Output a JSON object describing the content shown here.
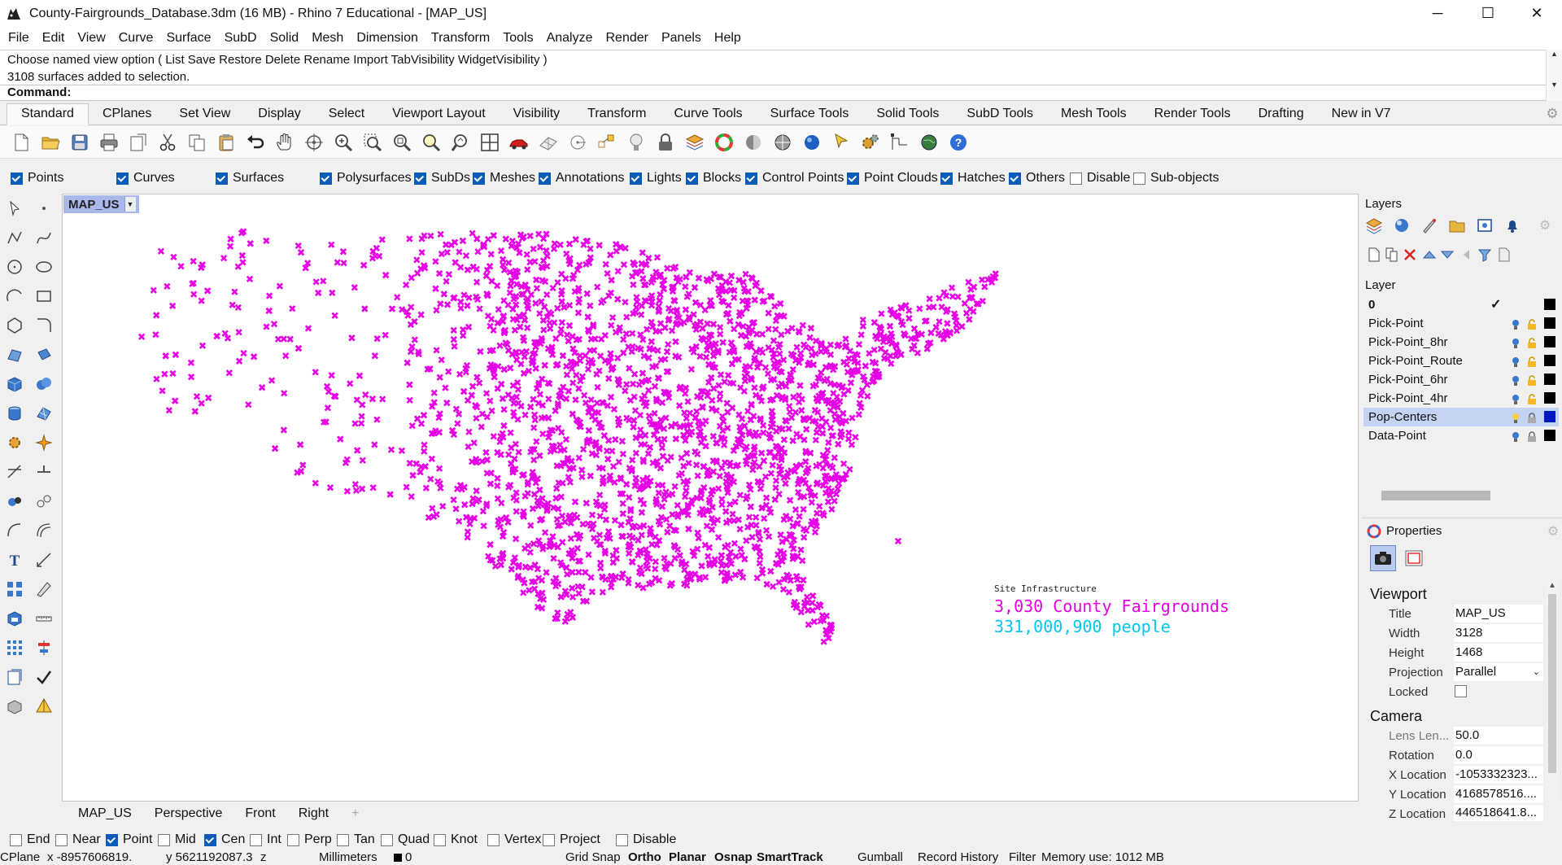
{
  "window": {
    "title": "County-Fairgrounds_Database.3dm (16 MB) - Rhino 7 Educational - [MAP_US]",
    "minimize": "─",
    "maximize": "☐",
    "close": "✕"
  },
  "menu": [
    "File",
    "Edit",
    "View",
    "Curve",
    "Surface",
    "SubD",
    "Solid",
    "Mesh",
    "Dimension",
    "Transform",
    "Tools",
    "Analyze",
    "Render",
    "Panels",
    "Help"
  ],
  "command": {
    "history": [
      "Choose named view option ( List  Save  Restore  Delete  Rename  Import  TabVisibility  WidgetVisibility )",
      "3108 surfaces added to selection."
    ],
    "prompt": "Command:"
  },
  "toolbar_tabs": [
    "Standard",
    "CPlanes",
    "Set View",
    "Display",
    "Select",
    "Viewport Layout",
    "Visibility",
    "Transform",
    "Curve Tools",
    "Surface Tools",
    "Solid Tools",
    "SubD Tools",
    "Mesh Tools",
    "Render Tools",
    "Drafting",
    "New in V7"
  ],
  "selection_filter": [
    {
      "label": "Points",
      "checked": true
    },
    {
      "label": "Curves",
      "checked": true
    },
    {
      "label": "Surfaces",
      "checked": true
    },
    {
      "label": "Polysurfaces",
      "checked": true
    },
    {
      "label": "SubDs",
      "checked": true
    },
    {
      "label": "Meshes",
      "checked": true
    },
    {
      "label": "Annotations",
      "checked": true
    },
    {
      "label": "Lights",
      "checked": true
    },
    {
      "label": "Blocks",
      "checked": true
    },
    {
      "label": "Control Points",
      "checked": true
    },
    {
      "label": "Point Clouds",
      "checked": true
    },
    {
      "label": "Hatches",
      "checked": true
    },
    {
      "label": "Others",
      "checked": true
    },
    {
      "label": "Disable",
      "checked": false
    },
    {
      "label": "Sub-objects",
      "checked": false
    }
  ],
  "viewport": {
    "name": "MAP_US",
    "point_color": "#e600e6",
    "annotation": {
      "small": "Site Infrastructure",
      "fairgrounds": "3,030 County Fairgrounds",
      "people": "331,000,900 people"
    }
  },
  "viewport_tabs": [
    "MAP_US",
    "Perspective",
    "Front",
    "Right"
  ],
  "osnap": [
    {
      "label": "End",
      "checked": false
    },
    {
      "label": "Near",
      "checked": false
    },
    {
      "label": "Point",
      "checked": true
    },
    {
      "label": "Mid",
      "checked": false
    },
    {
      "label": "Cen",
      "checked": true
    },
    {
      "label": "Int",
      "checked": false
    },
    {
      "label": "Perp",
      "checked": false
    },
    {
      "label": "Tan",
      "checked": false
    },
    {
      "label": "Quad",
      "checked": false
    },
    {
      "label": "Knot",
      "checked": false
    },
    {
      "label": "Vertex",
      "checked": false
    },
    {
      "label": "Project",
      "checked": false
    },
    {
      "label": "Disable",
      "checked": false
    }
  ],
  "status": {
    "cplane": "CPlane",
    "x": "x -8957606819.",
    "y": "y 5621192087.3",
    "z": "z",
    "units": "Millimeters",
    "layer": "0",
    "grid_snap": "Grid Snap",
    "ortho": "Ortho",
    "planar": "Planar",
    "osnap": "Osnap",
    "smarttrack": "SmartTrack",
    "gumball": "Gumball",
    "record_history": "Record History",
    "filter": "Filter",
    "memory": "Memory use: 1012 MB"
  },
  "layers_panel": {
    "title": "Layers",
    "header": "Layer",
    "layers": [
      {
        "name": "0",
        "current": true,
        "color": "#000000"
      },
      {
        "name": "Pick-Point",
        "current": false,
        "color": "#000000"
      },
      {
        "name": "Pick-Point_8hr",
        "current": false,
        "color": "#000000"
      },
      {
        "name": "Pick-Point_Route",
        "current": false,
        "color": "#000000"
      },
      {
        "name": "Pick-Point_6hr",
        "current": false,
        "color": "#000000"
      },
      {
        "name": "Pick-Point_4hr",
        "current": false,
        "color": "#000000"
      },
      {
        "name": "Pop-Centers",
        "current": false,
        "selected": true,
        "color": "#0018c8"
      },
      {
        "name": "Data-Point",
        "current": false,
        "color": "#000000"
      }
    ]
  },
  "properties_panel": {
    "title": "Properties",
    "viewport_heading": "Viewport",
    "viewport_props": [
      {
        "label": "Title",
        "value": "MAP_US"
      },
      {
        "label": "Width",
        "value": "3128"
      },
      {
        "label": "Height",
        "value": "1468"
      },
      {
        "label": "Projection",
        "value": "Parallel"
      },
      {
        "label": "Locked",
        "value": ""
      }
    ],
    "camera_heading": "Camera",
    "camera_props": [
      {
        "label": "Lens Len...",
        "value": "50.0"
      },
      {
        "label": "Rotation",
        "value": "0.0"
      },
      {
        "label": "X Location",
        "value": "-1053332323..."
      },
      {
        "label": "Y Location",
        "value": "4168578516...."
      },
      {
        "label": "Z Location",
        "value": "446518641.8..."
      }
    ]
  }
}
